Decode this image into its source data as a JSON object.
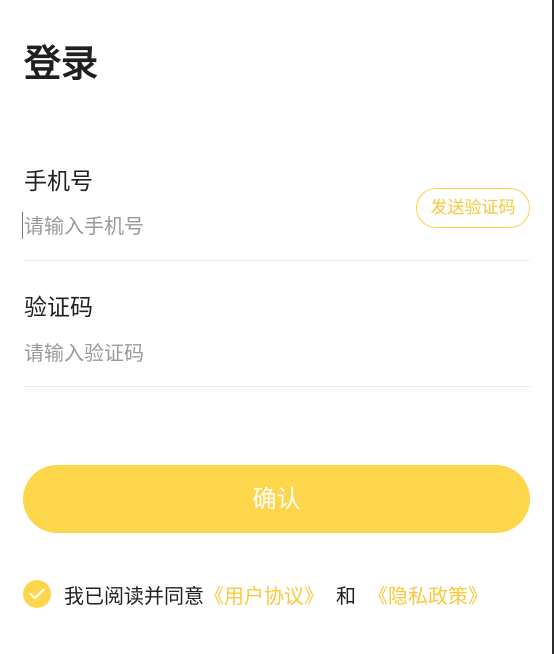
{
  "title": "登录",
  "phone": {
    "label": "手机号",
    "placeholder": "请输入手机号",
    "value": ""
  },
  "send_code": {
    "label": "发送验证码"
  },
  "code": {
    "label": "验证码",
    "placeholder": "请输入验证码",
    "value": ""
  },
  "confirm": {
    "label": "确认"
  },
  "agreement": {
    "checked": true,
    "prefix": "我已阅读并同意",
    "user_agreement": "《用户协议》",
    "conjunction": "和",
    "privacy_policy": "《隐私政策》"
  },
  "colors": {
    "accent": "#fdd64b",
    "accent_text": "#f6c83a",
    "placeholder": "#9a9a9a",
    "divider": "#ececec"
  },
  "icons": {
    "agreement_checkbox": "check-circle-icon"
  }
}
